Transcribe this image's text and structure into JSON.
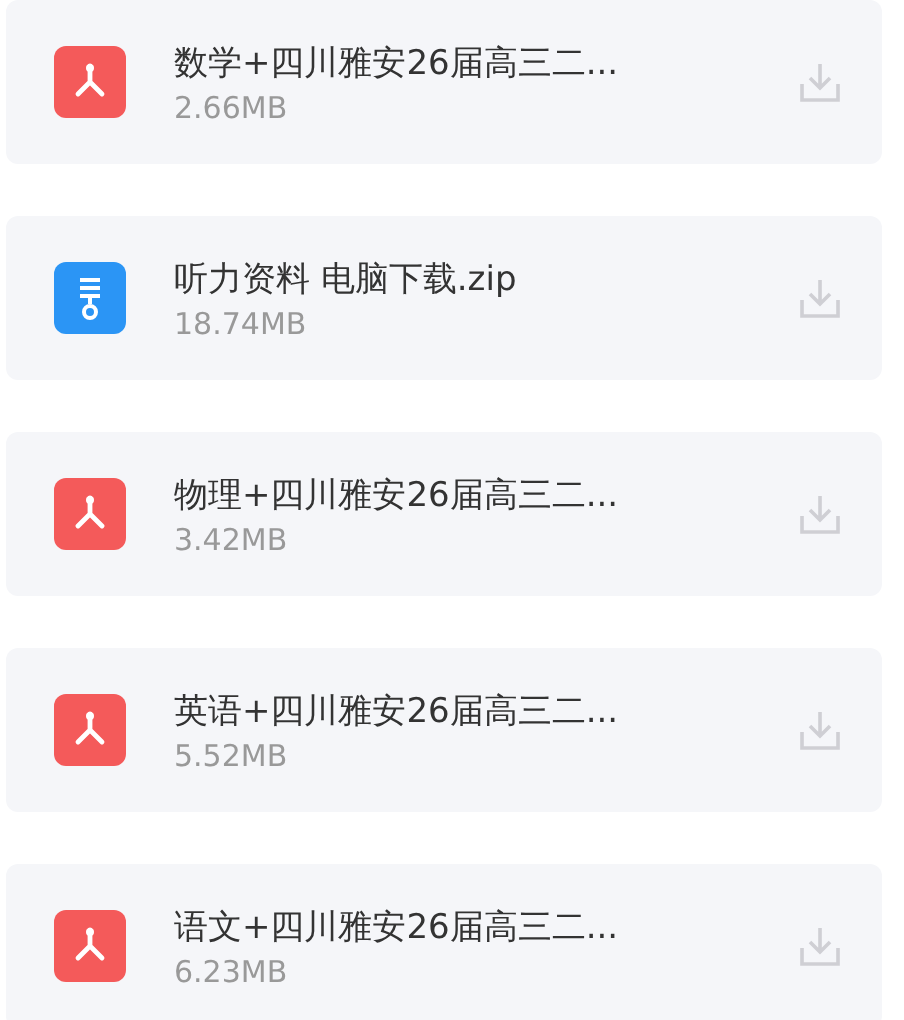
{
  "files": [
    {
      "kind": "pdf",
      "name": "数学+四川雅安26届高三二...",
      "size": "2.66MB"
    },
    {
      "kind": "zip",
      "name": "听力资料 电脑下载.zip",
      "size": "18.74MB"
    },
    {
      "kind": "pdf",
      "name": "物理+四川雅安26届高三二...",
      "size": "3.42MB"
    },
    {
      "kind": "pdf",
      "name": "英语+四川雅安26届高三二...",
      "size": "5.52MB"
    },
    {
      "kind": "pdf",
      "name": "语文+四川雅安26届高三二...",
      "size": "6.23MB"
    }
  ]
}
